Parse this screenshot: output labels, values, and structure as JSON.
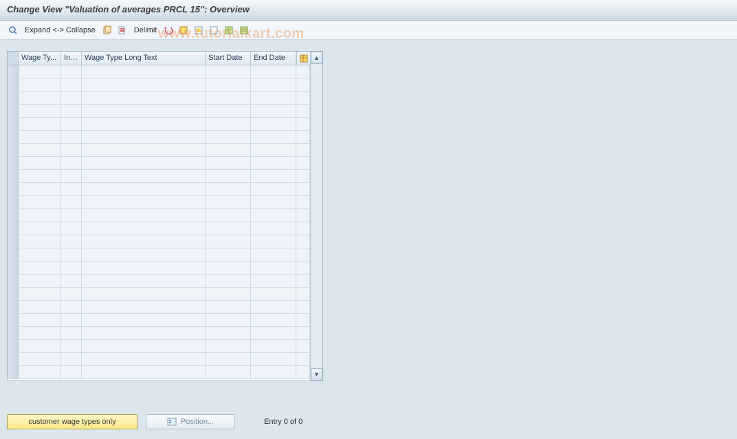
{
  "title": "Change View \"Valuation of averages PRCL 15\": Overview",
  "toolbar": {
    "expand_collapse": "Expand <-> Collapse",
    "delimit": "Delimit"
  },
  "table": {
    "columns": {
      "wage_ty": "Wage Ty...",
      "inf": "Inf...",
      "long_text": "Wage Type Long Text",
      "start_date": "Start Date",
      "end_date": "End Date"
    },
    "row_count": 24
  },
  "footer": {
    "customer_btn": "customer wage types only",
    "position_btn": "Position...",
    "entry_status": "Entry 0 of 0"
  },
  "watermark": "www.tutorialkart.com"
}
